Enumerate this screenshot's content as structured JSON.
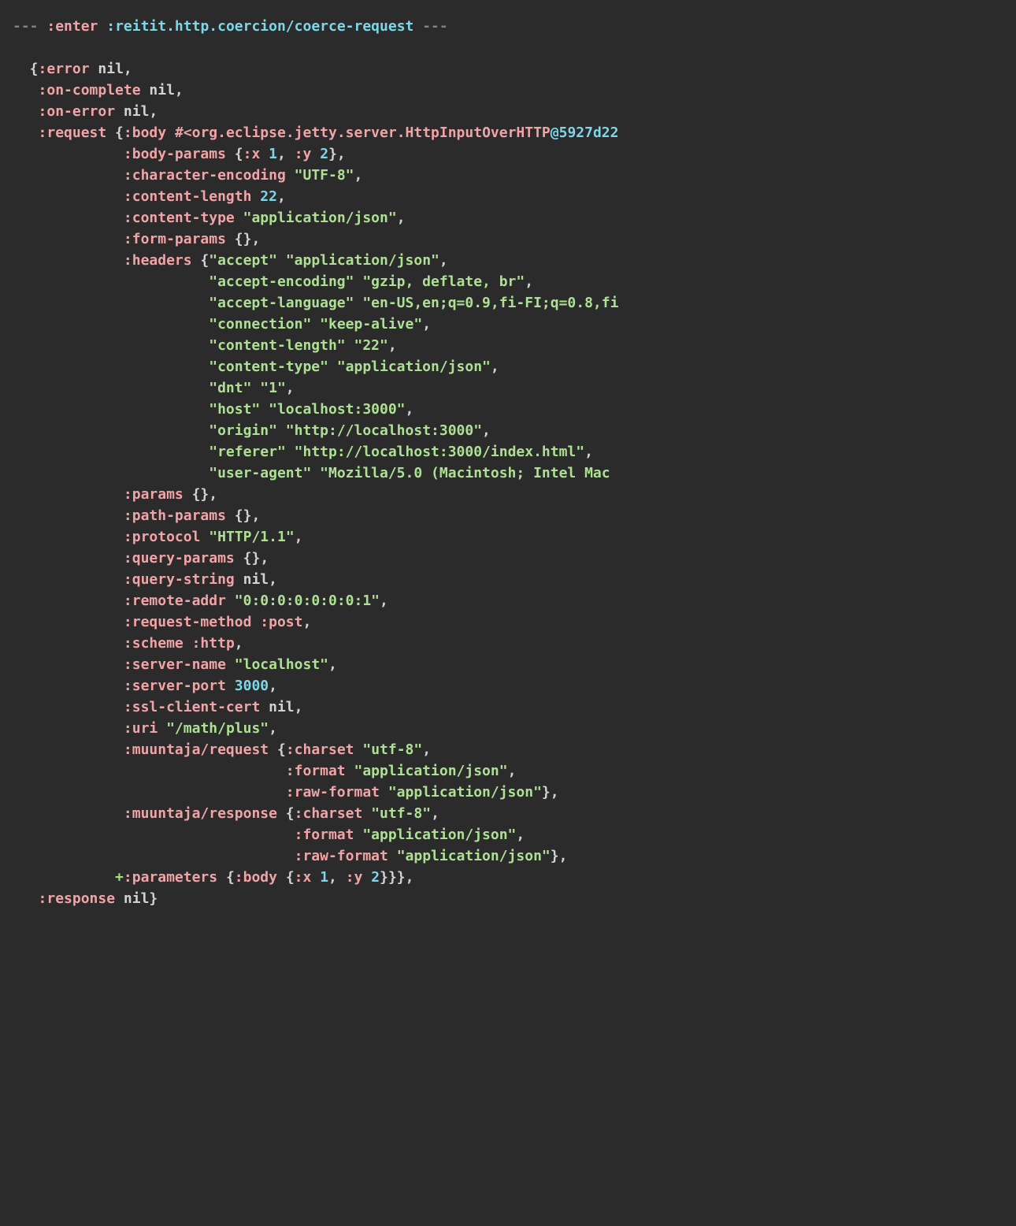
{
  "header": {
    "dash_left": "--- ",
    "enter": ":enter",
    "space": " ",
    "path": ":reitit.http.coercion/coerce-request",
    "dash_right": " ---"
  },
  "map": {
    "open": "  {",
    "error_k": ":error",
    "error_v": "nil",
    "on_complete_k": ":on-complete",
    "on_complete_v": "nil",
    "on_error_k": ":on-error",
    "on_error_v": "nil",
    "request_k": ":request",
    "request_open": " {",
    "body_k": ":body",
    "body_v": "#<org.eclipse.jetty.server.HttpInputOverHTTP",
    "body_id": "@5927d22",
    "body_params_k": ":body-params",
    "bp_open": " {",
    "bp_x_k": ":x",
    "bp_x_v": "1",
    "bp_y_k": ":y",
    "bp_y_v": "2",
    "char_enc_k": ":character-encoding",
    "char_enc_v": "\"UTF-8\"",
    "content_length_k": ":content-length",
    "content_length_v": "22",
    "content_type_k": ":content-type",
    "content_type_v": "\"application/json\"",
    "form_params_k": ":form-params",
    "form_params_v": "{}",
    "headers_k": ":headers",
    "headers_open": " {",
    "h_accept_k": "\"accept\"",
    "h_accept_v": "\"application/json\"",
    "h_ae_k": "\"accept-encoding\"",
    "h_ae_v": "\"gzip, deflate, br\"",
    "h_al_k": "\"accept-language\"",
    "h_al_v": "\"en-US,en;q=0.9,fi-FI;q=0.8,fi",
    "h_conn_k": "\"connection\"",
    "h_conn_v": "\"keep-alive\"",
    "h_cl_k": "\"content-length\"",
    "h_cl_v": "\"22\"",
    "h_ct_k": "\"content-type\"",
    "h_ct_v": "\"application/json\"",
    "h_dnt_k": "\"dnt\"",
    "h_dnt_v": "\"1\"",
    "h_host_k": "\"host\"",
    "h_host_v": "\"localhost:3000\"",
    "h_origin_k": "\"origin\"",
    "h_origin_v": "\"http://localhost:3000\"",
    "h_ref_k": "\"referer\"",
    "h_ref_v": "\"http://localhost:3000/index.html\"",
    "h_ua_k": "\"user-agent\"",
    "h_ua_v": "\"Mozilla/5.0 (Macintosh; Intel Mac ",
    "params_k": ":params",
    "params_v": "{}",
    "path_params_k": ":path-params",
    "path_params_v": "{}",
    "protocol_k": ":protocol",
    "protocol_v": "\"HTTP/1.1\"",
    "query_params_k": ":query-params",
    "query_params_v": "{}",
    "query_string_k": ":query-string",
    "query_string_v": "nil",
    "remote_addr_k": ":remote-addr",
    "remote_addr_v": "\"0:0:0:0:0:0:0:1\"",
    "request_method_k": ":request-method",
    "request_method_v": ":post",
    "scheme_k": ":scheme",
    "scheme_v": ":http",
    "server_name_k": ":server-name",
    "server_name_v": "\"localhost\"",
    "server_port_k": ":server-port",
    "server_port_v": "3000",
    "ssl_k": ":ssl-client-cert",
    "ssl_v": "nil",
    "uri_k": ":uri",
    "uri_v": "\"/math/plus\"",
    "muunt_req_k": ":muuntaja/request",
    "mr_open": " {",
    "mr_charset_k": ":charset",
    "mr_charset_v": "\"utf-8\"",
    "mr_format_k": ":format",
    "mr_format_v": "\"application/json\"",
    "mr_raw_k": ":raw-format",
    "mr_raw_v": "\"application/json\"",
    "muunt_res_k": ":muuntaja/response",
    "mr2_open": " {",
    "mr2_charset_k": ":charset",
    "mr2_charset_v": "\"utf-8\"",
    "mr2_format_k": ":format",
    "mr2_format_v": "\"application/json\"",
    "mr2_raw_k": ":raw-format",
    "mr2_raw_v": "\"application/json\"",
    "plus": "+",
    "parameters_k": ":parameters",
    "par_open": " {",
    "par_body_k": ":body",
    "par_body_open": " {",
    "par_x_k": ":x",
    "par_x_v": "1",
    "par_y_k": ":y",
    "par_y_v": "2",
    "response_k": ":response",
    "response_v": "nil"
  },
  "ind": {
    "top": "   ",
    "req": "             ",
    "hdr": "                       ",
    "mr": "                                ",
    "mr2": "                                 ",
    "plus": "            "
  }
}
